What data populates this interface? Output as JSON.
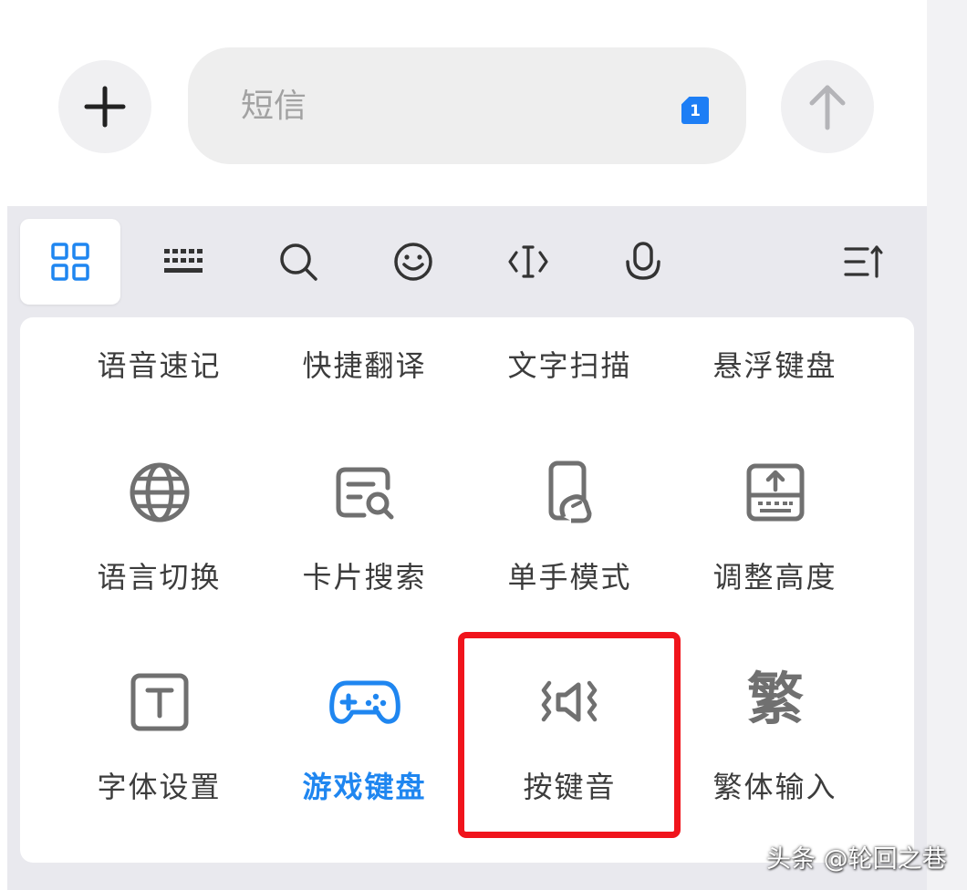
{
  "compose": {
    "add_icon": "plus-icon",
    "message_placeholder": "短信",
    "sim_badge": "1",
    "send_icon": "arrow-up-icon"
  },
  "toolbar": {
    "tabs": [
      {
        "icon": "grid-icon",
        "active": true
      },
      {
        "icon": "keyboard-icon",
        "active": false
      },
      {
        "icon": "search-icon",
        "active": false
      },
      {
        "icon": "emoji-icon",
        "active": false
      },
      {
        "icon": "text-cursor-icon",
        "active": false
      },
      {
        "icon": "microphone-icon",
        "active": false
      },
      {
        "icon": "collapse-menu-icon",
        "active": false
      }
    ]
  },
  "tools": {
    "row1": [
      "语音速记",
      "快捷翻译",
      "文字扫描",
      "悬浮键盘"
    ],
    "row2": [
      {
        "label": "语言切换",
        "icon": "globe-icon"
      },
      {
        "label": "卡片搜索",
        "icon": "card-search-icon"
      },
      {
        "label": "单手模式",
        "icon": "one-hand-icon"
      },
      {
        "label": "调整高度",
        "icon": "adjust-height-icon"
      }
    ],
    "row3": [
      {
        "label": "字体设置",
        "icon": "font-icon"
      },
      {
        "label": "游戏键盘",
        "icon": "gamepad-icon",
        "highlighted": true
      },
      {
        "label": "按键音",
        "icon": "key-sound-icon"
      },
      {
        "label": "繁体输入",
        "icon": "traditional-char-icon",
        "glyph": "繁"
      }
    ]
  },
  "colors": {
    "accent_blue": "#1f86f0",
    "highlight_red": "#f0141c",
    "icon_gray": "#707070"
  },
  "watermark": "头条 @轮回之巷"
}
